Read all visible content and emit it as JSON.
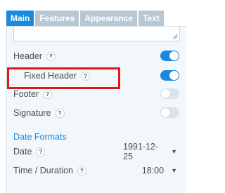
{
  "tabs": [
    {
      "label": "Main",
      "active": true
    },
    {
      "label": "Features",
      "active": false
    },
    {
      "label": "Appearance",
      "active": false
    },
    {
      "label": "Text",
      "active": false
    }
  ],
  "settings": {
    "header": {
      "label": "Header",
      "help": "?",
      "enabled": true
    },
    "fixed_header": {
      "label": "Fixed Header",
      "help": "?",
      "enabled": true
    },
    "footer": {
      "label": "Footer",
      "help": "?",
      "enabled": false
    },
    "signature": {
      "label": "Signature",
      "help": "?",
      "enabled": false
    }
  },
  "date_formats": {
    "title": "Date Formats",
    "date": {
      "label": "Date",
      "help": "?",
      "value": "1991-12-25"
    },
    "time": {
      "label": "Time / Duration",
      "help": "?",
      "value": "18:00"
    }
  },
  "colors": {
    "accent": "#1a8ae0",
    "highlight": "#e4141b"
  }
}
